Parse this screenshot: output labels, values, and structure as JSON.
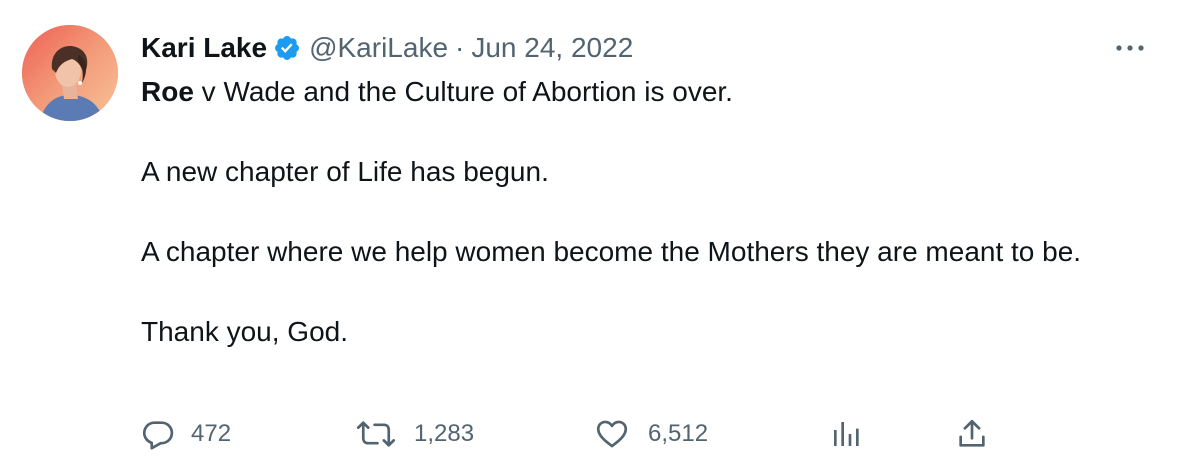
{
  "author": {
    "display_name": "Kari Lake",
    "handle": "@KariLake",
    "separator": "·",
    "date": "Jun 24, 2022",
    "verified_icon": "verified-badge-icon",
    "avatar": "profile-photo"
  },
  "tweet": {
    "line1_bold": "Roe",
    "line1_rest": " v Wade and the Culture of Abortion is over.",
    "line2": "A new chapter of Life has begun.",
    "line3": "A chapter where we help women become the Mothers they are meant to be.",
    "line4": "Thank you, God."
  },
  "actions": {
    "reply": {
      "icon": "reply-icon",
      "count": "472"
    },
    "retweet": {
      "icon": "retweet-icon",
      "count": "1,283"
    },
    "like": {
      "icon": "heart-icon",
      "count": "6,512"
    },
    "analytics": {
      "icon": "analytics-icon"
    },
    "share": {
      "icon": "share-icon"
    }
  },
  "more_menu_icon": "more-icon",
  "colors": {
    "text_primary": "#0f1419",
    "text_secondary": "#536471",
    "verified_blue": "#1d9bf0"
  }
}
